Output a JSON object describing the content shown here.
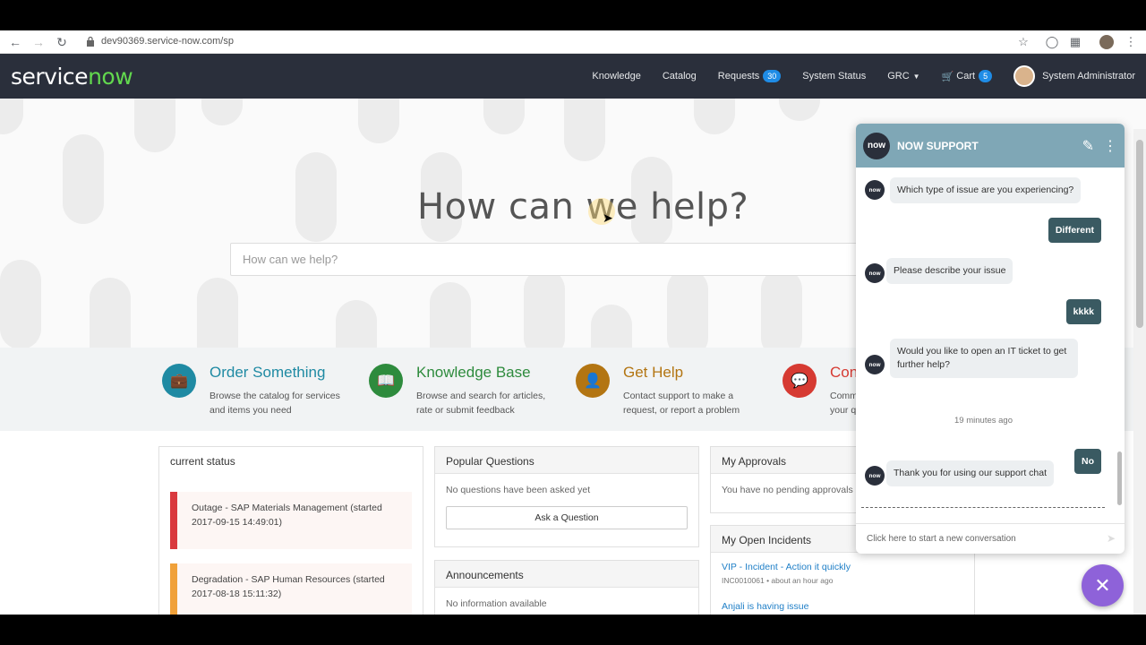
{
  "browser": {
    "url": "dev90369.service-now.com/sp"
  },
  "header": {
    "logo_service": "service",
    "logo_now": "now",
    "nav": {
      "knowledge": "Knowledge",
      "catalog": "Catalog",
      "requests": "Requests",
      "requests_count": "30",
      "system_status": "System Status",
      "grc": "GRC",
      "cart": "Cart",
      "cart_count": "5",
      "user": "System Administrator"
    }
  },
  "hero": {
    "title": "How can we help?",
    "search_placeholder": "How can we help?"
  },
  "features": [
    {
      "title": "Order Something",
      "desc": "Browse the catalog for services and items you need",
      "color": "#1f8aa3",
      "icon": "briefcase-icon"
    },
    {
      "title": "Knowledge Base",
      "desc": "Browse and search for articles, rate or submit feedback",
      "color": "#2e8b3d",
      "icon": "book-icon"
    },
    {
      "title": "Get Help",
      "desc": "Contact support to make a request, or report a problem",
      "color": "#b37512",
      "icon": "person-icon"
    },
    {
      "title": "Con",
      "desc": "Comm your q",
      "color": "#d63a32",
      "icon": "chat-bubbles-icon"
    }
  ],
  "widgets": {
    "current_status": {
      "title": "current status",
      "items": [
        {
          "text": "Outage - SAP Materials Management (started 2017-09-15 14:49:01)",
          "color": "#d9393e"
        },
        {
          "text": "Degradation - SAP Human Resources (started 2017-08-18 15:11:32)",
          "color": "#f0a13a"
        }
      ]
    },
    "popular_questions": {
      "title": "Popular Questions",
      "empty": "No questions have been asked yet",
      "ask_label": "Ask a Question"
    },
    "announcements": {
      "title": "Announcements",
      "empty": "No information available"
    },
    "my_approvals": {
      "title": "My Approvals",
      "empty": "You have no pending approvals"
    },
    "my_open_incidents": {
      "title": "My Open Incidents",
      "items": [
        {
          "title": "VIP - Incident - Action it quickly",
          "sub": "INC0010061 • about an hour ago"
        },
        {
          "title": "Anjali is having issue",
          "sub": ""
        }
      ]
    }
  },
  "chat": {
    "title": "NOW SUPPORT",
    "logo_text": "now",
    "messages": [
      {
        "from": "bot",
        "text": "Which type of issue are you experiencing?"
      },
      {
        "from": "user",
        "text": "Different"
      },
      {
        "from": "bot",
        "text": "Please describe your issue"
      },
      {
        "from": "user",
        "text": "kkkk"
      },
      {
        "from": "bot",
        "text": "Would you like to open an IT ticket to get further help?"
      },
      {
        "from": "user",
        "text": "No"
      },
      {
        "from": "bot",
        "text": "Thank you for using our support chat"
      }
    ],
    "timestamp": "19 minutes ago",
    "footer": "Click here to start a new conversation"
  }
}
